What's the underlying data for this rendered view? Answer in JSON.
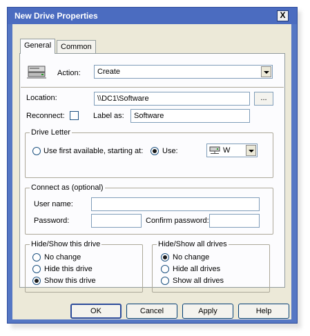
{
  "window": {
    "title": "New Drive Properties",
    "close_glyph": "X"
  },
  "tabs": [
    {
      "label": "General",
      "active": true
    },
    {
      "label": "Common",
      "active": false
    }
  ],
  "general": {
    "icon": "drive-map-icon",
    "action_label": "Action:",
    "action_value": "Create",
    "location_label": "Location:",
    "location_value": "\\\\DC1\\Software",
    "browse_label": "...",
    "reconnect_label": "Reconnect:",
    "reconnect_checked": false,
    "label_as_label": "Label as:",
    "label_as_value": "Software"
  },
  "drive_letter": {
    "group_label": "Drive Letter",
    "option_first": "Use first available, starting at:",
    "option_use": "Use:",
    "selected": "use",
    "letter_icon": "network-drive-icon",
    "letter_value": "W"
  },
  "connect_as": {
    "group_label": "Connect as (optional)",
    "username_label": "User name:",
    "username_value": "",
    "password_label": "Password:",
    "password_value": "",
    "confirm_label": "Confirm password:",
    "confirm_value": ""
  },
  "hide_show_this": {
    "group_label": "Hide/Show this drive",
    "options": [
      "No change",
      "Hide this drive",
      "Show this drive"
    ],
    "selected_index": 2
  },
  "hide_show_all": {
    "group_label": "Hide/Show all drives",
    "options": [
      "No change",
      "Hide all drives",
      "Show all drives"
    ],
    "selected_index": 0
  },
  "buttons": {
    "ok": "OK",
    "cancel": "Cancel",
    "apply": "Apply",
    "help": "Help"
  }
}
